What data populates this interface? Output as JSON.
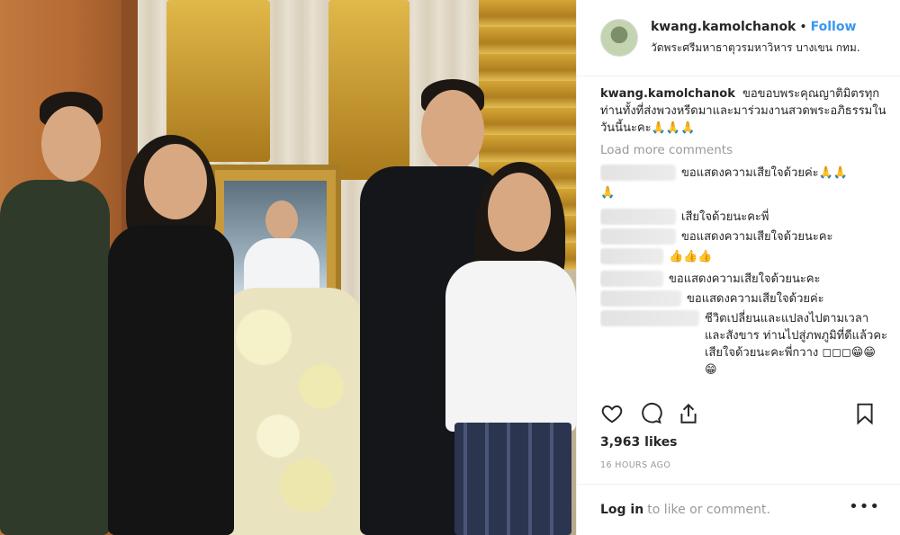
{
  "post": {
    "username": "kwang.kamolchanok",
    "follow_label": "Follow",
    "location": "วัดพระศรีมหาธาตุวรมหาวิหาร บางเขน กทม."
  },
  "caption": {
    "username": "kwang.kamolchanok",
    "text": "ขอขอบพระคุณญาติมิตรทุกท่านทั้งที่ส่งพวงหรีดมาและมาร่วมงานสวดพระอภิธรรมในวันนี้นะคะ🙏🙏🙏"
  },
  "load_more_label": "Load more comments",
  "comments": [
    {
      "text": "ขอแสดงความเสียใจด้วยค่ะ🙏🙏"
    },
    {
      "text": "🙏"
    },
    {
      "text": "เสียใจด้วยนะคะพี่"
    },
    {
      "text": "ขอแสดงความเสียใจด้วยนะคะ"
    },
    {
      "text": "👍👍👍"
    },
    {
      "text": "ขอแสดงความเสียใจด้วยนะคะ"
    },
    {
      "text": "ขอแสดงความเสียใจด้วยค่ะ"
    },
    {
      "text": "ชีวิตเปลี่ยนและแปลงไปตามเวลาและสังขาร ท่านไปสู่ภพภูมิที่ดีแล้วคะ เสียใจด้วยนะคะพี่กวาง ◻◻◻😁😁😁"
    }
  ],
  "likes": "3,963 likes",
  "timestamp": "16 HOURS AGO",
  "footer": {
    "login_label": "Log in",
    "rest": "to like or comment.",
    "more_label": "•••"
  },
  "icons": [
    "heart-icon",
    "comment-icon",
    "share-icon",
    "bookmark-icon"
  ]
}
